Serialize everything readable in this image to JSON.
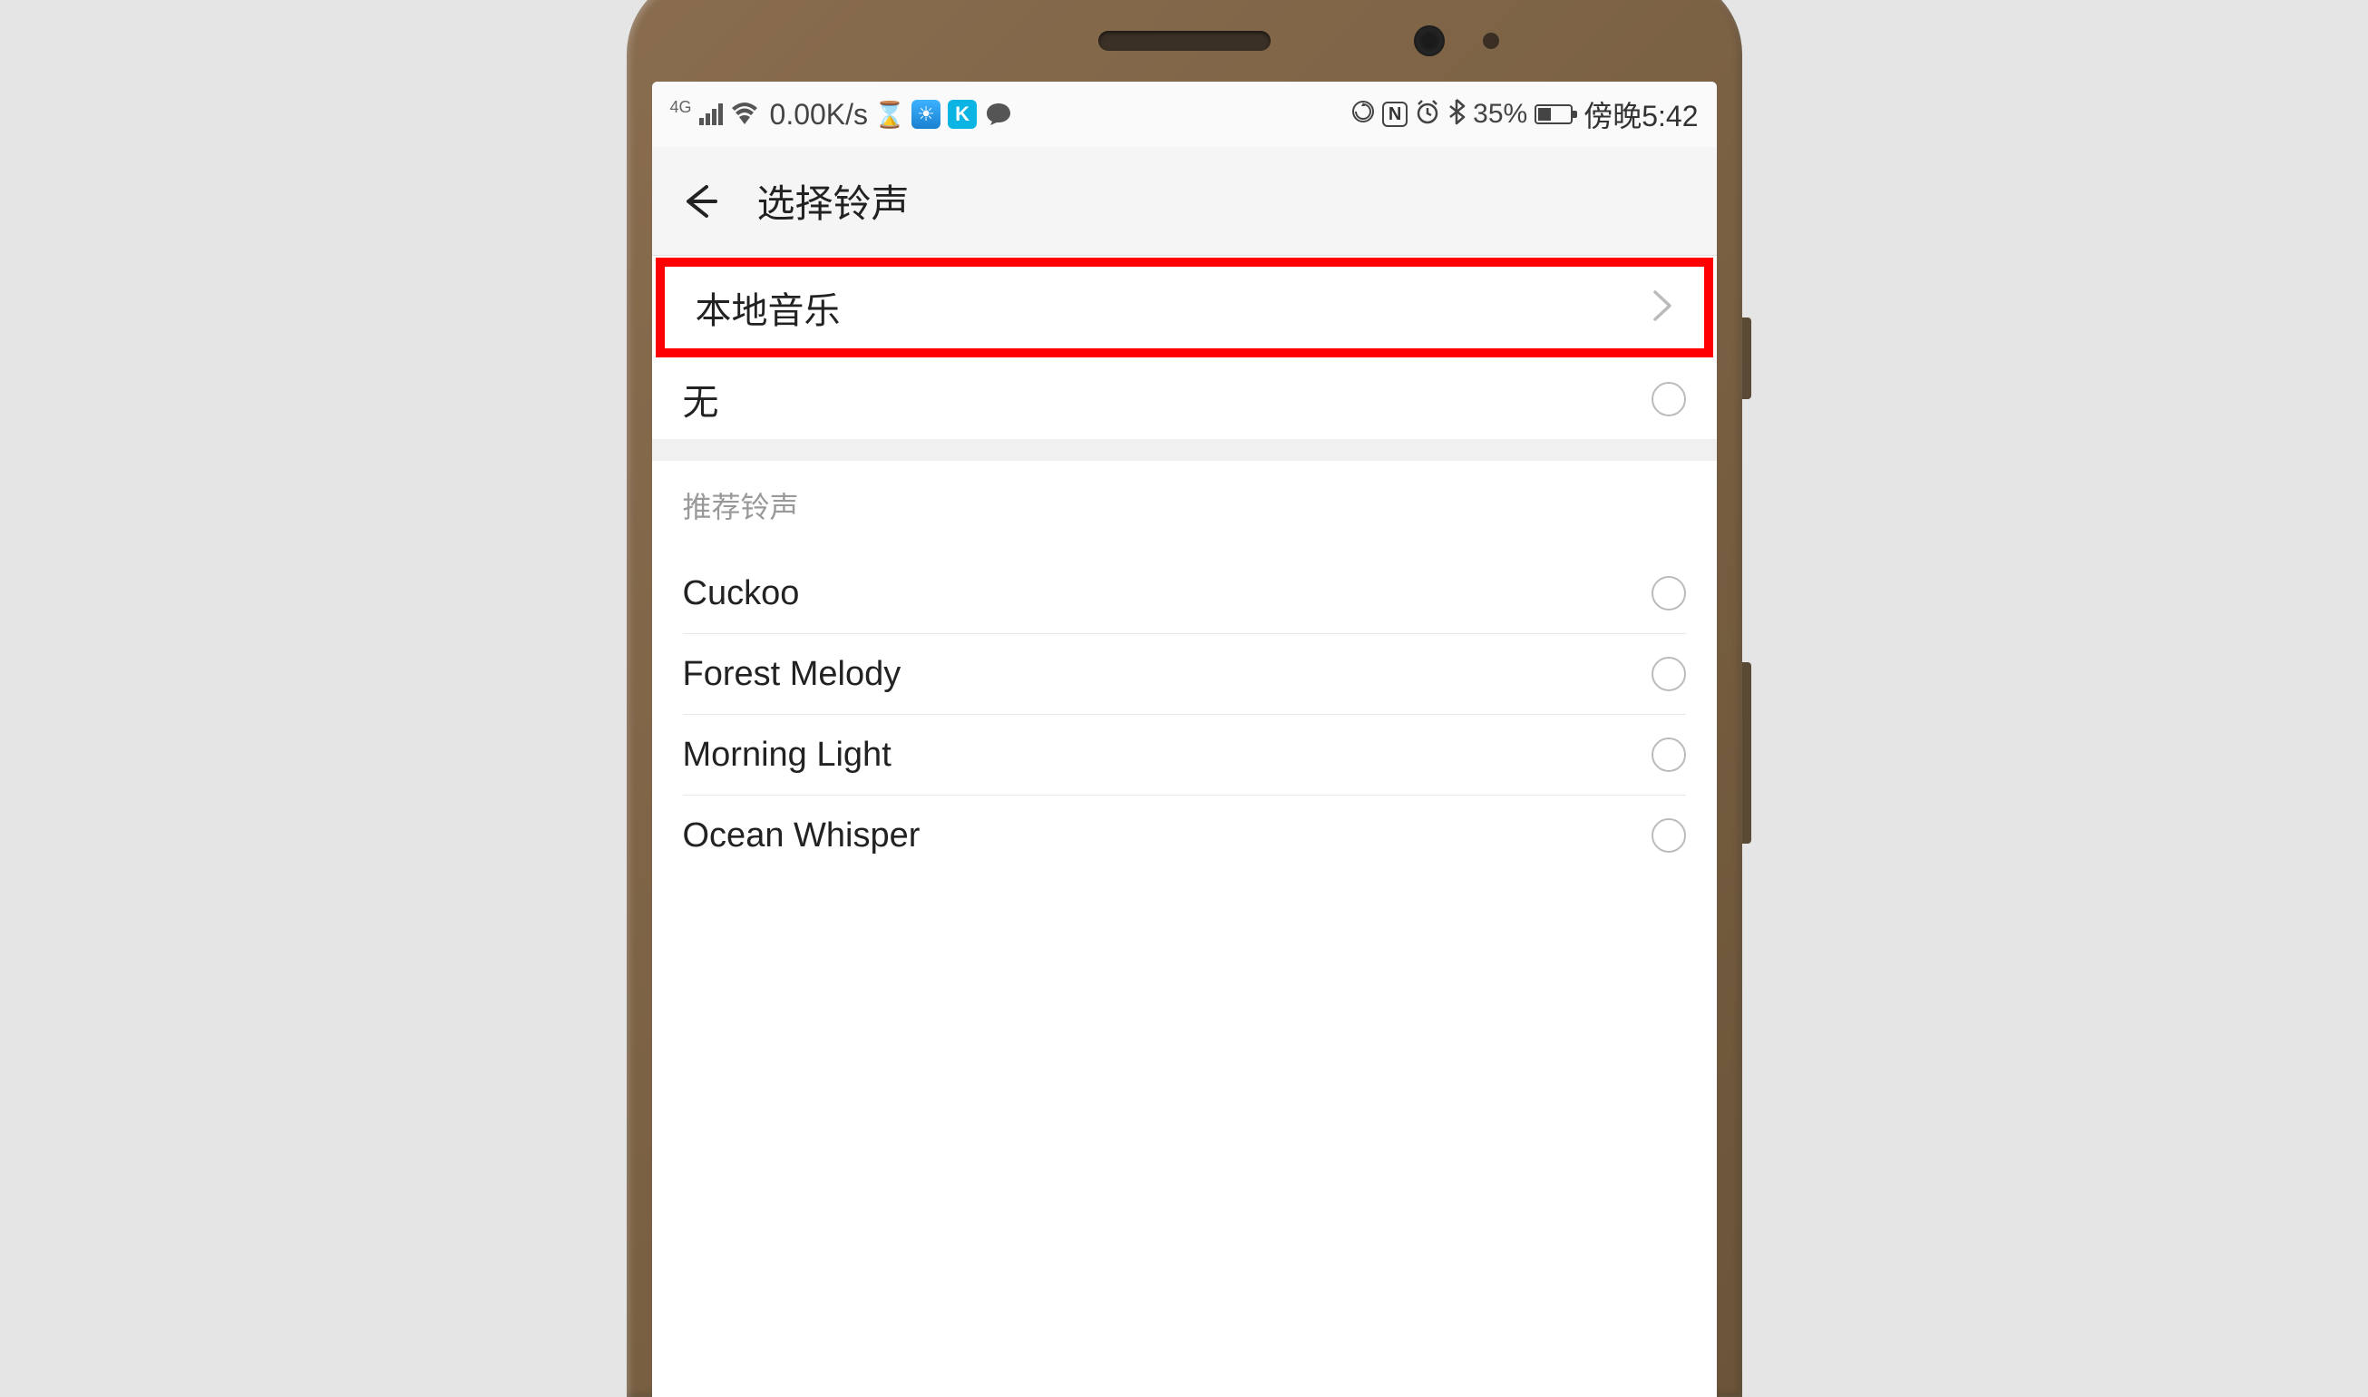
{
  "status_bar": {
    "network_type": "4G",
    "data_speed": "0.00K/s",
    "battery_pct": "35%",
    "time": "傍晚5:42",
    "icons": {
      "hourglass": "⧗",
      "weather": "☀",
      "k_app": "K",
      "chat": "●",
      "sync": "⟳",
      "nfc": "N",
      "alarm": "⏰",
      "bluetooth": "✱"
    }
  },
  "header": {
    "title": "选择铃声"
  },
  "rows": {
    "local_music": "本地音乐",
    "none": "无"
  },
  "section": {
    "recommended": "推荐铃声"
  },
  "ringtones": [
    {
      "name": "Cuckoo"
    },
    {
      "name": "Forest Melody"
    },
    {
      "name": "Morning Light"
    },
    {
      "name": "Ocean Whisper"
    }
  ]
}
